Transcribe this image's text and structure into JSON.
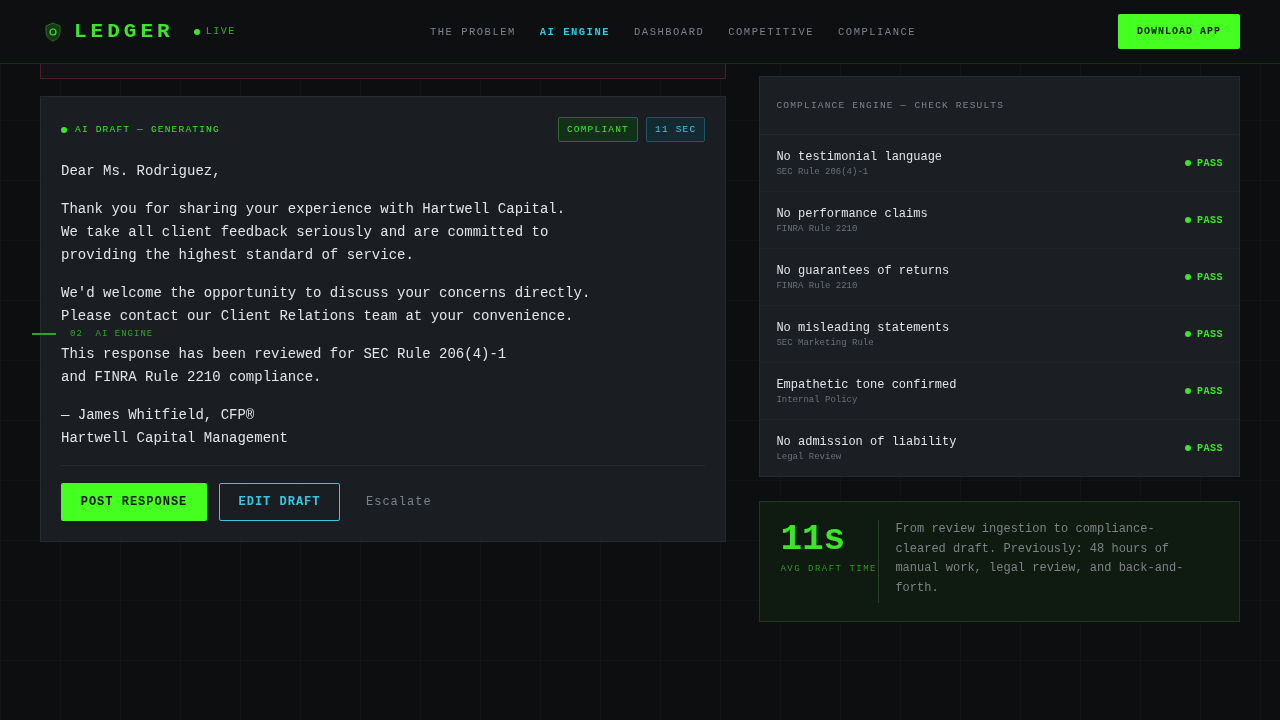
{
  "header": {
    "brand": "LEDGER",
    "live": "LIVE",
    "nav": [
      {
        "label": "THE PROBLEM",
        "selected": false
      },
      {
        "label": "AI ENGINE",
        "selected": true
      },
      {
        "label": "DASHBOARD",
        "selected": false
      },
      {
        "label": "COMPETITIVE",
        "selected": false
      },
      {
        "label": "COMPLIANCE",
        "selected": false
      }
    ],
    "cta": "DOWNLOAD APP"
  },
  "side_nav": {
    "active": {
      "number": "02",
      "label": "AI ENGINE"
    }
  },
  "draft": {
    "status": "AI DRAFT — GENERATING",
    "badges": [
      {
        "kind": "compliant",
        "label": "COMPLIANT"
      },
      {
        "kind": "time",
        "label": "11 SEC"
      }
    ],
    "paragraphs": [
      [
        "Dear Ms. Rodriguez,"
      ],
      [
        "Thank you for sharing your experience with Hartwell Capital.",
        "We take all client feedback seriously and are committed to",
        "providing the highest standard of service."
      ],
      [
        "We'd welcome the opportunity to discuss your concerns directly.",
        "Please contact our Client Relations team at your convenience."
      ],
      [
        "This response has been reviewed for SEC Rule 206(4)-1",
        "and FINRA Rule 2210 compliance."
      ],
      [
        "— James Whitfield, CFP®",
        "Hartwell Capital Management"
      ]
    ],
    "actions": [
      {
        "kind": "primary",
        "label": "POST RESPONSE"
      },
      {
        "kind": "outline",
        "label": "EDIT DRAFT"
      },
      {
        "kind": "text",
        "label": "Escalate"
      }
    ]
  },
  "compliance": {
    "title": "COMPLIANCE ENGINE — CHECK RESULTS",
    "checks": [
      {
        "name": "No testimonial language",
        "rule": "SEC Rule 206(4)-1",
        "passed": true,
        "result": "PASS"
      },
      {
        "name": "No performance claims",
        "rule": "FINRA Rule 2210",
        "passed": true,
        "result": "PASS"
      },
      {
        "name": "No guarantees of returns",
        "rule": "FINRA Rule 2210",
        "passed": true,
        "result": "PASS"
      },
      {
        "name": "No misleading statements",
        "rule": "SEC Marketing Rule",
        "passed": true,
        "result": "PASS"
      },
      {
        "name": "Empathetic tone confirmed",
        "rule": "Internal Policy",
        "passed": true,
        "result": "PASS"
      },
      {
        "name": "No admission of liability",
        "rule": "Legal Review",
        "passed": true,
        "result": "PASS"
      }
    ]
  },
  "stat": {
    "value": "11s",
    "label": "AVG DRAFT TIME",
    "description": "From review ingestion to compliance-cleared draft. Previously: 48 hours of manual work, legal review, and back-and-forth."
  }
}
